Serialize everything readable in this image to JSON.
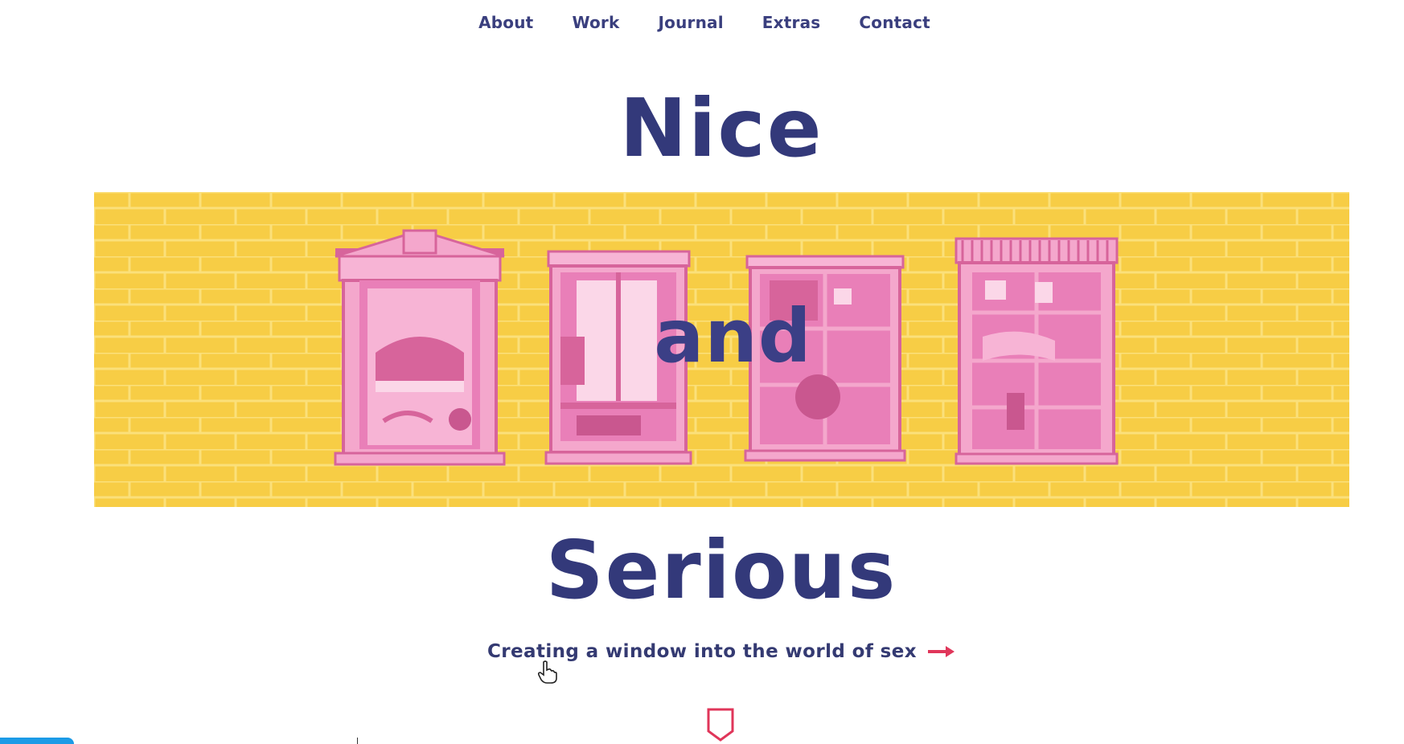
{
  "nav": {
    "items": [
      {
        "label": "About"
      },
      {
        "label": "Work"
      },
      {
        "label": "Journal"
      },
      {
        "label": "Extras"
      },
      {
        "label": "Contact"
      }
    ]
  },
  "hero": {
    "title_top": "Nice",
    "title_middle": "and",
    "title_bottom": "Serious",
    "tagline": "Creating a window into the world of sex"
  },
  "colors": {
    "brand_navy": "#33397a",
    "banner_yellow": "#f7cd45",
    "window_pink": "#e97fb8",
    "arrow_red": "#e0365a"
  },
  "icons": {
    "arrow": "arrow-right-icon",
    "shield": "shield-icon",
    "cursor": "hand-cursor-icon"
  }
}
